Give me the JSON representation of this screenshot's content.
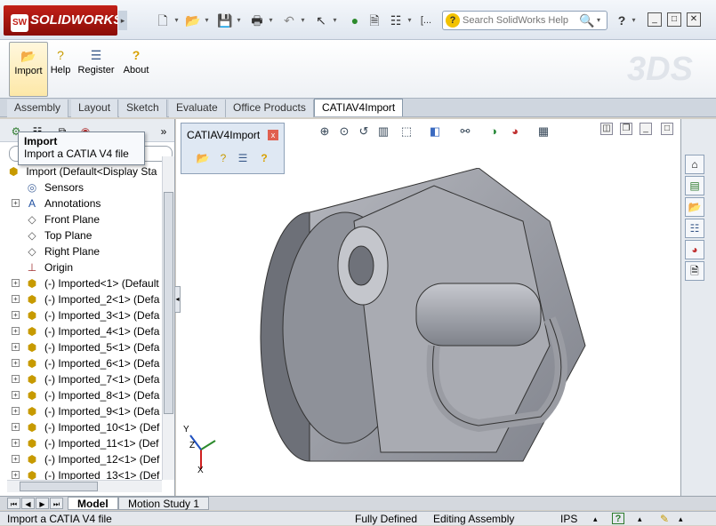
{
  "app": {
    "title": "SOLIDWORKS",
    "logo_mark": "SW"
  },
  "titlebar": {
    "search": {
      "placeholder": "Search SolidWorks Help"
    },
    "overflow": "[..."
  },
  "ribbon": {
    "buttons": [
      {
        "label": "Import",
        "icon": "folder-open-icon"
      },
      {
        "label": "Help",
        "icon": "help-doc-icon"
      },
      {
        "label": "Register",
        "icon": "register-icon"
      },
      {
        "label": "About",
        "icon": "about-icon"
      }
    ],
    "brand_mark": "3DS"
  },
  "tabs": [
    "Assembly",
    "Layout",
    "Sketch",
    "Evaluate",
    "Office Products",
    "CATIAV4Import"
  ],
  "active_tab": "CATIAV4Import",
  "tooltip": {
    "title": "Import",
    "text": "Import a CATIA V4 file"
  },
  "tree": {
    "root": "Import  (Default<Display Sta",
    "items": [
      {
        "label": "Sensors",
        "icon": "sensor-icon",
        "expand": false
      },
      {
        "label": "Annotations",
        "icon": "annotation-icon",
        "expand": true
      },
      {
        "label": "Front Plane",
        "icon": "plane-icon",
        "expand": false
      },
      {
        "label": "Top Plane",
        "icon": "plane-icon",
        "expand": false
      },
      {
        "label": "Right Plane",
        "icon": "plane-icon",
        "expand": false
      },
      {
        "label": "Origin",
        "icon": "origin-icon",
        "expand": false
      },
      {
        "label": "(-) Imported<1> (Default",
        "icon": "part-icon",
        "expand": true
      },
      {
        "label": "(-) Imported_2<1> (Defa",
        "icon": "part-icon",
        "expand": true
      },
      {
        "label": "(-) Imported_3<1> (Defa",
        "icon": "part-icon",
        "expand": true
      },
      {
        "label": "(-) Imported_4<1> (Defa",
        "icon": "part-icon",
        "expand": true
      },
      {
        "label": "(-) Imported_5<1> (Defa",
        "icon": "part-icon",
        "expand": true
      },
      {
        "label": "(-) Imported_6<1> (Defa",
        "icon": "part-icon",
        "expand": true
      },
      {
        "label": "(-) Imported_7<1> (Defa",
        "icon": "part-icon",
        "expand": true
      },
      {
        "label": "(-) Imported_8<1> (Defa",
        "icon": "part-icon",
        "expand": true
      },
      {
        "label": "(-) Imported_9<1> (Defa",
        "icon": "part-icon",
        "expand": true
      },
      {
        "label": "(-) Imported_10<1> (Def",
        "icon": "part-icon",
        "expand": true
      },
      {
        "label": "(-) Imported_11<1> (Def",
        "icon": "part-icon",
        "expand": true
      },
      {
        "label": "(-) Imported_12<1> (Def",
        "icon": "part-icon",
        "expand": true
      },
      {
        "label": "(-) Imported_13<1> (Def",
        "icon": "part-icon",
        "expand": true
      }
    ]
  },
  "catia_toolbar": {
    "title": "CATIAV4Import",
    "close": "x"
  },
  "triad": {
    "x": "X",
    "y": "Y",
    "z": "Z"
  },
  "bottom_tabs": [
    "Model",
    "Motion Study 1"
  ],
  "status": {
    "message": "Import a CATIA V4 file",
    "state": "Fully Defined",
    "mode": "Editing Assembly",
    "units": "IPS",
    "help": "?"
  },
  "colors": {
    "accent": "#c22018",
    "model": "#9ea0a8"
  }
}
